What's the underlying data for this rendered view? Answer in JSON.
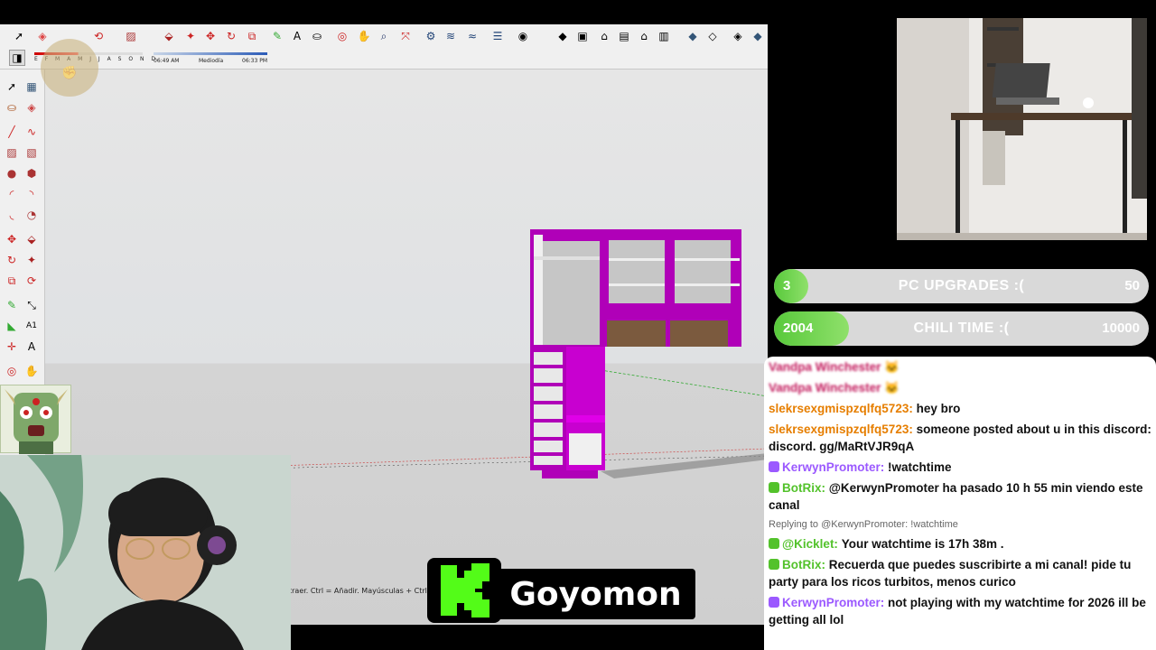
{
  "sketchup": {
    "shadow_times": {
      "start": "06:49 AM",
      "mid": "Mediodía",
      "end": "06:33 PM"
    },
    "months_label": "E F M A M J J A S O N D",
    "status_hint": "traer. Ctrl = Añadir. Mayúsculas + Ctrl ="
  },
  "goals": [
    {
      "current": "3",
      "title": "PC UPGRADES :(",
      "target": "50",
      "progress": 0.06
    },
    {
      "current": "2004",
      "title": "CHILI TIME :(",
      "target": "10000",
      "progress": 0.2
    }
  ],
  "chat": {
    "messages": [
      {
        "user": "slekrsexgmispzqlfq5723:",
        "text": "hey bro",
        "user_color": "#e67e00"
      },
      {
        "user": "slekrsexgmispzqlfq5723:",
        "text": "someone posted about u in this discord: discord. gg/MaRtVJR9qA",
        "user_color": "#e67e00"
      },
      {
        "user": "KerwynPromoter:",
        "text": "!watchtime",
        "user_color": "#9b59ff"
      },
      {
        "user": "BotRix:",
        "text": "@KerwynPromoter ha pasado 10 h 55 min viendo este canal",
        "user_color": "#53c22b"
      },
      {
        "reply": "Replying to @KerwynPromoter: !watchtime"
      },
      {
        "user": "@Kicklet:",
        "text": "Your watchtime is 17h 38m .",
        "user_color": "#53c22b"
      },
      {
        "user": "BotRix:",
        "text": "Recuerda que puedes suscribirte a mi canal! pide tu party para los ricos turbitos, menos curico",
        "user_color": "#53c22b"
      },
      {
        "user": "KerwynPromoter:",
        "text": "not playing with my watchtime for 2026 ill be getting all lol",
        "user_color": "#9b59ff"
      }
    ]
  },
  "kick": {
    "logo_letter": "K",
    "streamer": "Goyomon"
  },
  "colors": {
    "accent_magenta": "#c000c8",
    "goal_green": "#58c93b",
    "kick_green": "#53fc18"
  }
}
